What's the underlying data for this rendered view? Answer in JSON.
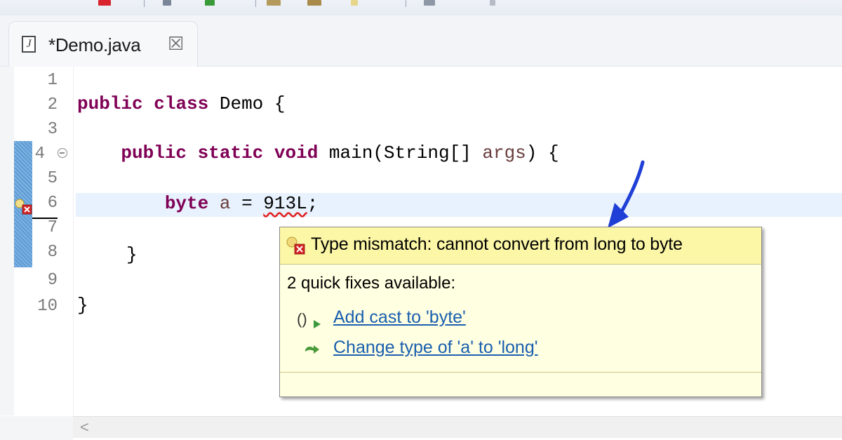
{
  "tab": {
    "title": "*Demo.java",
    "file_icon_letter": "J",
    "close_glyph": "☒"
  },
  "gutter": {
    "line_numbers": [
      "1",
      "2",
      "3",
      "4",
      "5",
      "6",
      "7",
      "8",
      "9",
      "10"
    ]
  },
  "code": {
    "line2": {
      "kw1": "public",
      "kw2": "class",
      "rest": "Demo {"
    },
    "line4": {
      "kw1": "public",
      "kw2": "static",
      "kw3": "void",
      "name": "main(String[] ",
      "param": "args",
      "rest": ") {"
    },
    "line6": {
      "type": "byte",
      "var": "a",
      "op": "=",
      "literal": "913L",
      "semi": ";"
    },
    "line8": "}",
    "line10": "}"
  },
  "popup": {
    "title": "Type mismatch: cannot convert from long to byte",
    "subtitle": "2 quick fixes available:",
    "fixes": [
      {
        "label": "Add cast to 'byte'",
        "icon": "cast-icon"
      },
      {
        "label": "Change type of 'a' to 'long'",
        "icon": "change-type-icon"
      }
    ]
  },
  "scrollbar": {
    "left_glyph": "<"
  },
  "colors": {
    "keyword": "#7f0055",
    "variable": "#6a3e3e",
    "link": "#1a5faf",
    "popup_bg": "#ffffe1",
    "popup_header_bg": "#fcf7a6",
    "current_line": "#e8f2fe",
    "arrow": "#1f3fd6"
  }
}
